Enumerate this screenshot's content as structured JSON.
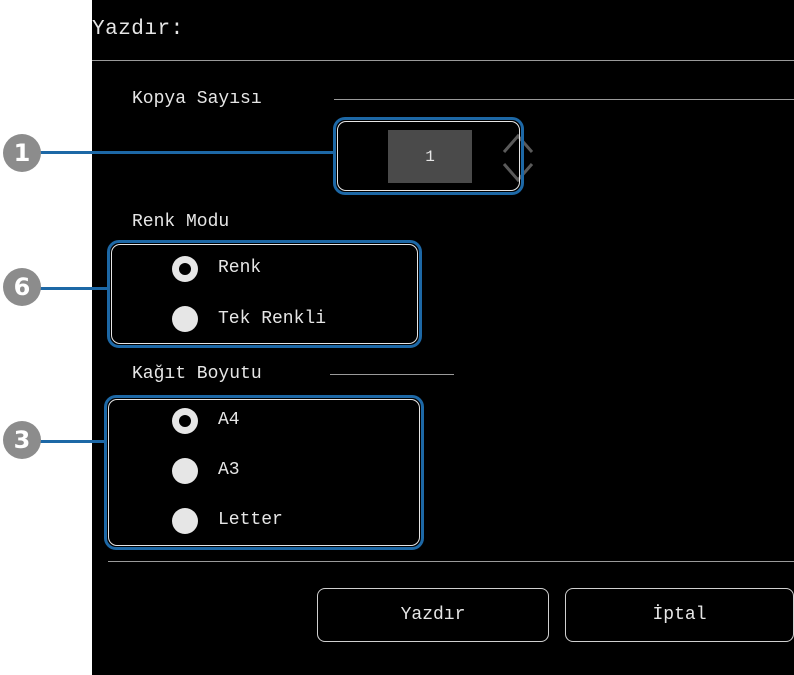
{
  "dialog": {
    "title": "Yazdır:"
  },
  "copies": {
    "label": "Kopya Sayısı",
    "value": "1",
    "stepper_icon": "up-down-chevron-icon"
  },
  "color_mode": {
    "label": "Renk Modu",
    "options": [
      {
        "label": "Renk",
        "selected": true
      },
      {
        "label": "Tek Renkli",
        "selected": false
      }
    ]
  },
  "paper_size": {
    "label": "Kağıt Boyutu",
    "options": [
      {
        "label": "A4",
        "selected": true
      },
      {
        "label": "A3",
        "selected": false
      },
      {
        "label": "Letter",
        "selected": false
      }
    ]
  },
  "buttons": {
    "print": "Yazdır",
    "cancel": "İptal"
  },
  "callouts": [
    "1",
    "6",
    "3"
  ],
  "colors": {
    "callout": "#1d68a6",
    "background": "#000000",
    "text": "#e6e6e6",
    "badge": "#8c8c8c"
  }
}
